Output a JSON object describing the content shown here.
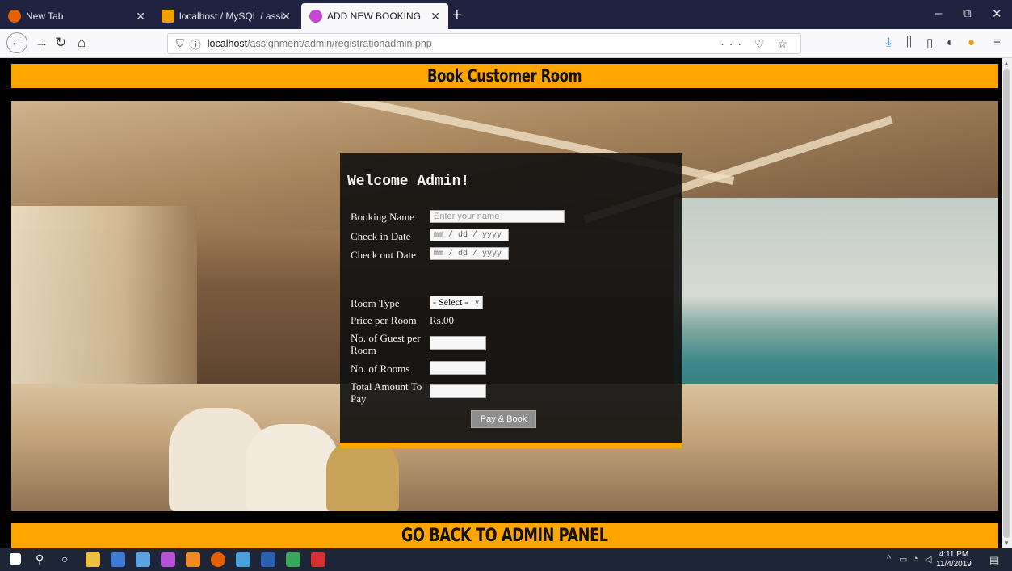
{
  "browser": {
    "tabs": [
      {
        "label": "New Tab",
        "favicon_color": "#e66000"
      },
      {
        "label": "localhost / MySQL / assignmen",
        "favicon_color": "#f0a000"
      },
      {
        "label": "ADD NEW BOOKING",
        "favicon_color": "#c745d3"
      }
    ],
    "url_host": "localhost",
    "url_path": "/assignment/admin/registrationadmin.php",
    "url_right_icons": "··· ♡ ☆"
  },
  "page": {
    "title_banner": "Book Customer Room",
    "footer_banner": "GO BACK TO ADMIN PANEL",
    "accent_color": "#ffa500"
  },
  "form": {
    "heading": "Welcome Admin!",
    "booking_name_label": "Booking Name",
    "booking_name_placeholder": "Enter your name",
    "checkin_label": "Check in Date",
    "checkin_placeholder": "mm / dd / yyyy",
    "checkout_label": "Check out Date",
    "checkout_placeholder": "mm / dd / yyyy",
    "room_type_label": "Room Type",
    "room_type_selected": "- Select -",
    "price_label": "Price per Room",
    "price_value": "Rs.00",
    "guests_label": "No. of Guest per Room",
    "rooms_label": "No. of Rooms",
    "total_label": "Total Amount To Pay",
    "submit_label": "Pay & Book"
  },
  "taskbar": {
    "time": "4:11 PM",
    "date": "11/4/2019"
  }
}
